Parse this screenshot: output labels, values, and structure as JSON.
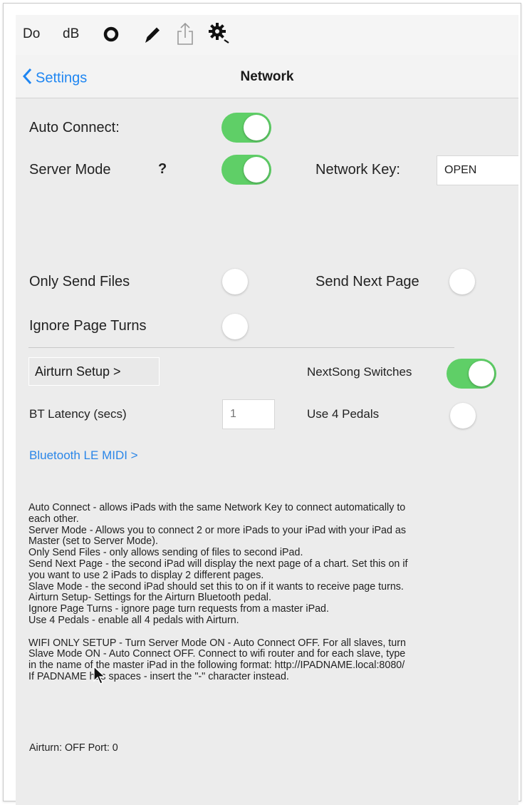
{
  "toolbar": {
    "do_label": "Do",
    "db_label": "dB"
  },
  "navbar": {
    "back_label": "Settings",
    "title": "Network"
  },
  "settings": {
    "auto_connect_label": "Auto Connect:",
    "auto_connect_on": true,
    "server_mode_label": "Server Mode",
    "server_mode_help": "?",
    "server_mode_on": true,
    "network_key_label": "Network Key:",
    "network_key_value": "OPEN",
    "only_send_files_label": "Only Send Files",
    "only_send_files_on": false,
    "send_next_page_label": "Send Next Page",
    "send_next_page_on": false,
    "ignore_page_turns_label": "Ignore Page Turns",
    "ignore_page_turns_on": false,
    "airturn_setup_label": "Airturn Setup  >",
    "nextsong_switches_label": "NextSong Switches",
    "nextsong_switches_on": true,
    "bt_latency_label": "BT Latency (secs)",
    "bt_latency_placeholder": "1",
    "use_4_pedals_label": "Use 4 Pedals",
    "use_4_pedals_on": false,
    "bluetooth_link": "Bluetooth LE MIDI >"
  },
  "help": {
    "lines": [
      "Auto Connect - allows iPads with the same Network Key to connect automatically to",
      "each other.",
      "Server Mode - Allows you to connect 2 or more iPads to your iPad with your iPad as",
      "Master (set to Server Mode).",
      "Only Send Files - only allows sending of files to second iPad.",
      "Send Next Page - the second iPad will display the next page of a chart. Set this on if",
      "you want to use 2 iPads to display 2 different pages.",
      "Slave Mode - the second iPad should set this to on if it wants to receive page turns.",
      "Airturn Setup- Settings for the Airturn Bluetooth pedal.",
      "Ignore Page Turns - ignore page turn requests from a master iPad.",
      "Use 4 Pedals - enable all 4 pedals with Airturn.",
      "",
      "WIFI ONLY SETUP - Turn Server Mode ON - Auto Connect OFF. For all slaves, turn",
      "Slave Mode ON - Auto Connect OFF. Connect to wifi router and for each slave, type",
      "in the name of the master iPad in the following format: http://IPADNAME.local:8080/",
      "If PADNAME has spaces - insert the \"-\" character instead."
    ]
  },
  "footer": {
    "status": "Airturn: OFF Port: 0"
  },
  "icons": [
    "record-icon",
    "pencil-icon",
    "share-icon",
    "gear-icon",
    "back-chevron-icon",
    "cursor-icon"
  ],
  "colors": {
    "toggle_on": "#5fcf67",
    "link_blue": "#2a86e8",
    "background": "#ececec"
  }
}
